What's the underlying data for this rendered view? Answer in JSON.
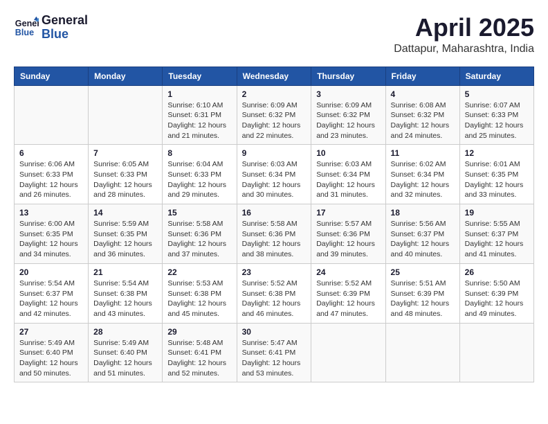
{
  "header": {
    "logo_line1": "General",
    "logo_line2": "Blue",
    "month": "April 2025",
    "location": "Dattapur, Maharashtra, India"
  },
  "days_of_week": [
    "Sunday",
    "Monday",
    "Tuesday",
    "Wednesday",
    "Thursday",
    "Friday",
    "Saturday"
  ],
  "weeks": [
    [
      {
        "day": "",
        "sunrise": "",
        "sunset": "",
        "daylight": ""
      },
      {
        "day": "",
        "sunrise": "",
        "sunset": "",
        "daylight": ""
      },
      {
        "day": "1",
        "sunrise": "Sunrise: 6:10 AM",
        "sunset": "Sunset: 6:31 PM",
        "daylight": "Daylight: 12 hours and 21 minutes."
      },
      {
        "day": "2",
        "sunrise": "Sunrise: 6:09 AM",
        "sunset": "Sunset: 6:32 PM",
        "daylight": "Daylight: 12 hours and 22 minutes."
      },
      {
        "day": "3",
        "sunrise": "Sunrise: 6:09 AM",
        "sunset": "Sunset: 6:32 PM",
        "daylight": "Daylight: 12 hours and 23 minutes."
      },
      {
        "day": "4",
        "sunrise": "Sunrise: 6:08 AM",
        "sunset": "Sunset: 6:32 PM",
        "daylight": "Daylight: 12 hours and 24 minutes."
      },
      {
        "day": "5",
        "sunrise": "Sunrise: 6:07 AM",
        "sunset": "Sunset: 6:33 PM",
        "daylight": "Daylight: 12 hours and 25 minutes."
      }
    ],
    [
      {
        "day": "6",
        "sunrise": "Sunrise: 6:06 AM",
        "sunset": "Sunset: 6:33 PM",
        "daylight": "Daylight: 12 hours and 26 minutes."
      },
      {
        "day": "7",
        "sunrise": "Sunrise: 6:05 AM",
        "sunset": "Sunset: 6:33 PM",
        "daylight": "Daylight: 12 hours and 28 minutes."
      },
      {
        "day": "8",
        "sunrise": "Sunrise: 6:04 AM",
        "sunset": "Sunset: 6:33 PM",
        "daylight": "Daylight: 12 hours and 29 minutes."
      },
      {
        "day": "9",
        "sunrise": "Sunrise: 6:03 AM",
        "sunset": "Sunset: 6:34 PM",
        "daylight": "Daylight: 12 hours and 30 minutes."
      },
      {
        "day": "10",
        "sunrise": "Sunrise: 6:03 AM",
        "sunset": "Sunset: 6:34 PM",
        "daylight": "Daylight: 12 hours and 31 minutes."
      },
      {
        "day": "11",
        "sunrise": "Sunrise: 6:02 AM",
        "sunset": "Sunset: 6:34 PM",
        "daylight": "Daylight: 12 hours and 32 minutes."
      },
      {
        "day": "12",
        "sunrise": "Sunrise: 6:01 AM",
        "sunset": "Sunset: 6:35 PM",
        "daylight": "Daylight: 12 hours and 33 minutes."
      }
    ],
    [
      {
        "day": "13",
        "sunrise": "Sunrise: 6:00 AM",
        "sunset": "Sunset: 6:35 PM",
        "daylight": "Daylight: 12 hours and 34 minutes."
      },
      {
        "day": "14",
        "sunrise": "Sunrise: 5:59 AM",
        "sunset": "Sunset: 6:35 PM",
        "daylight": "Daylight: 12 hours and 36 minutes."
      },
      {
        "day": "15",
        "sunrise": "Sunrise: 5:58 AM",
        "sunset": "Sunset: 6:36 PM",
        "daylight": "Daylight: 12 hours and 37 minutes."
      },
      {
        "day": "16",
        "sunrise": "Sunrise: 5:58 AM",
        "sunset": "Sunset: 6:36 PM",
        "daylight": "Daylight: 12 hours and 38 minutes."
      },
      {
        "day": "17",
        "sunrise": "Sunrise: 5:57 AM",
        "sunset": "Sunset: 6:36 PM",
        "daylight": "Daylight: 12 hours and 39 minutes."
      },
      {
        "day": "18",
        "sunrise": "Sunrise: 5:56 AM",
        "sunset": "Sunset: 6:37 PM",
        "daylight": "Daylight: 12 hours and 40 minutes."
      },
      {
        "day": "19",
        "sunrise": "Sunrise: 5:55 AM",
        "sunset": "Sunset: 6:37 PM",
        "daylight": "Daylight: 12 hours and 41 minutes."
      }
    ],
    [
      {
        "day": "20",
        "sunrise": "Sunrise: 5:54 AM",
        "sunset": "Sunset: 6:37 PM",
        "daylight": "Daylight: 12 hours and 42 minutes."
      },
      {
        "day": "21",
        "sunrise": "Sunrise: 5:54 AM",
        "sunset": "Sunset: 6:38 PM",
        "daylight": "Daylight: 12 hours and 43 minutes."
      },
      {
        "day": "22",
        "sunrise": "Sunrise: 5:53 AM",
        "sunset": "Sunset: 6:38 PM",
        "daylight": "Daylight: 12 hours and 45 minutes."
      },
      {
        "day": "23",
        "sunrise": "Sunrise: 5:52 AM",
        "sunset": "Sunset: 6:38 PM",
        "daylight": "Daylight: 12 hours and 46 minutes."
      },
      {
        "day": "24",
        "sunrise": "Sunrise: 5:52 AM",
        "sunset": "Sunset: 6:39 PM",
        "daylight": "Daylight: 12 hours and 47 minutes."
      },
      {
        "day": "25",
        "sunrise": "Sunrise: 5:51 AM",
        "sunset": "Sunset: 6:39 PM",
        "daylight": "Daylight: 12 hours and 48 minutes."
      },
      {
        "day": "26",
        "sunrise": "Sunrise: 5:50 AM",
        "sunset": "Sunset: 6:39 PM",
        "daylight": "Daylight: 12 hours and 49 minutes."
      }
    ],
    [
      {
        "day": "27",
        "sunrise": "Sunrise: 5:49 AM",
        "sunset": "Sunset: 6:40 PM",
        "daylight": "Daylight: 12 hours and 50 minutes."
      },
      {
        "day": "28",
        "sunrise": "Sunrise: 5:49 AM",
        "sunset": "Sunset: 6:40 PM",
        "daylight": "Daylight: 12 hours and 51 minutes."
      },
      {
        "day": "29",
        "sunrise": "Sunrise: 5:48 AM",
        "sunset": "Sunset: 6:41 PM",
        "daylight": "Daylight: 12 hours and 52 minutes."
      },
      {
        "day": "30",
        "sunrise": "Sunrise: 5:47 AM",
        "sunset": "Sunset: 6:41 PM",
        "daylight": "Daylight: 12 hours and 53 minutes."
      },
      {
        "day": "",
        "sunrise": "",
        "sunset": "",
        "daylight": ""
      },
      {
        "day": "",
        "sunrise": "",
        "sunset": "",
        "daylight": ""
      },
      {
        "day": "",
        "sunrise": "",
        "sunset": "",
        "daylight": ""
      }
    ]
  ]
}
